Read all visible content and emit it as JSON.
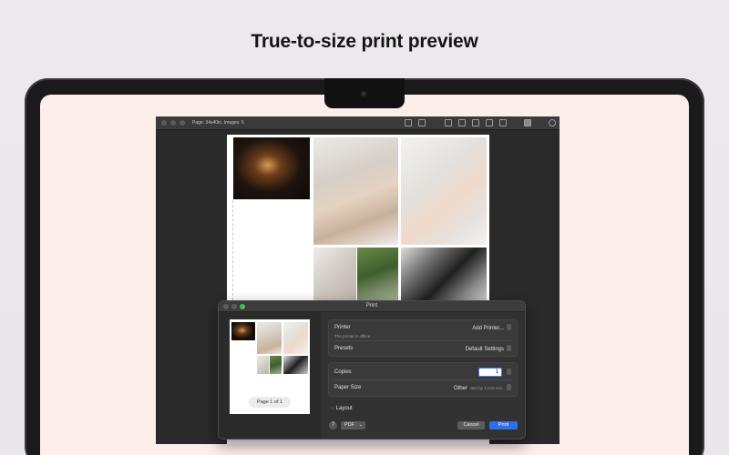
{
  "headline": "True-to-size print preview",
  "app": {
    "page_info": "Page: 34x40in.  Images: 5",
    "toolbar_icons": [
      "document-icon",
      "image-icon",
      "crop-icon",
      "layers-icon",
      "frame-icon",
      "rectangle-icon",
      "panel-icon",
      "print-icon",
      "settings-icon"
    ]
  },
  "dialog": {
    "title": "Print",
    "page_pill": "Page 1 of 1",
    "printer_label": "Printer",
    "printer_value": "Add Printer...",
    "printer_status": "The printer is offline.",
    "presets_label": "Presets",
    "presets_value": "Default Settings",
    "copies_label": "Copies",
    "copies_value": "1",
    "paper_label": "Paper Size",
    "paper_value": "Other",
    "paper_detail": "864 by 1,016 mm",
    "layout_label": "Layout",
    "help_label": "?",
    "pdf_label": "PDF",
    "cancel_label": "Cancel",
    "print_label": "Print"
  },
  "colors": {
    "screen_bg": "#fdeee9",
    "print_button": "#2f6fe8",
    "traffic_green": "#3cc24a"
  }
}
